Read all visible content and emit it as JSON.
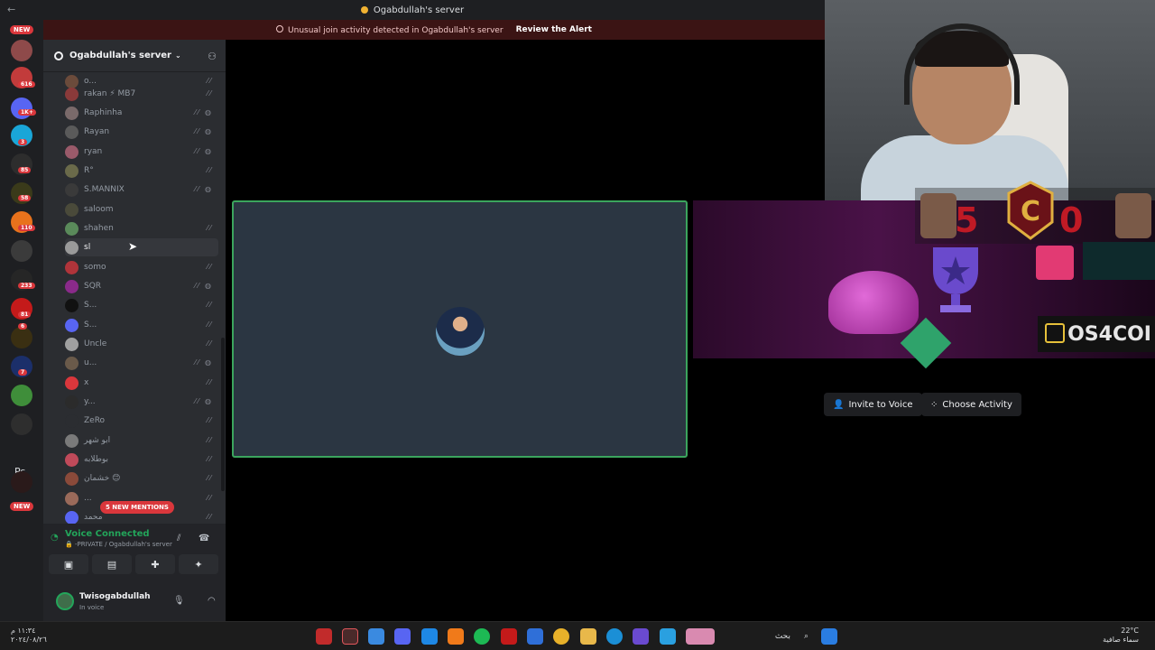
{
  "titlebar": {
    "nav": "←",
    "title": "Ogabdullah's server"
  },
  "alert": {
    "message": "Unusual join activity detected in Ogabdullah's server",
    "action": "Review the Alert"
  },
  "rail": {
    "new_top": "NEW",
    "new_bottom": "NEW",
    "ps_label": "Ps",
    "badges": [
      "616",
      "1K+",
      "3",
      "85",
      "58",
      "110",
      "233",
      "81",
      "6",
      "7"
    ]
  },
  "server": {
    "name": "Ogabdullah's server"
  },
  "members": [
    {
      "name": "o..."
    },
    {
      "name": "rakan ⚡ MB7"
    },
    {
      "name": "Raphinha"
    },
    {
      "name": "Rayan"
    },
    {
      "name": "ryan"
    },
    {
      "name": "R°"
    },
    {
      "name": "S.MANNIX"
    },
    {
      "name": "saloom"
    },
    {
      "name": "shahen"
    },
    {
      "name": "sl"
    },
    {
      "name": "somo"
    },
    {
      "name": "SQR"
    },
    {
      "name": "S..."
    },
    {
      "name": "S..."
    },
    {
      "name": "Uncle"
    },
    {
      "name": "u..."
    },
    {
      "name": "x"
    },
    {
      "name": "y..."
    },
    {
      "name": "ZeRo"
    },
    {
      "name": "ابو شهر"
    },
    {
      "name": "بوطلابه"
    },
    {
      "name": "خشمان 😊"
    },
    {
      "name": "..."
    },
    {
      "name": "محمد"
    }
  ],
  "mentions": "5 NEW MENTIONS",
  "voice": {
    "status": "Voice Connected",
    "channel": "🔒 -PRIVATE / Ogabdullah's server"
  },
  "user": {
    "name": "Twisogabdullah",
    "status": "In voice"
  },
  "activity": {
    "invite_label": "Invite to Voice",
    "choose_label": "Choose Activity",
    "banner_text": "OS4COI"
  },
  "scoreboard": {
    "left": "5",
    "right": "0",
    "crest": "C"
  },
  "taskbar": {
    "time": "١١:٣٤ م",
    "date": "٢٠٢٤/٠٨/٢٦",
    "search": "بحث",
    "temp": "22°C",
    "weather": "سماء صافية"
  },
  "colors": {
    "accent_green": "#23a55a",
    "alert_red": "#da373c",
    "sidebar": "#2b2d31"
  }
}
